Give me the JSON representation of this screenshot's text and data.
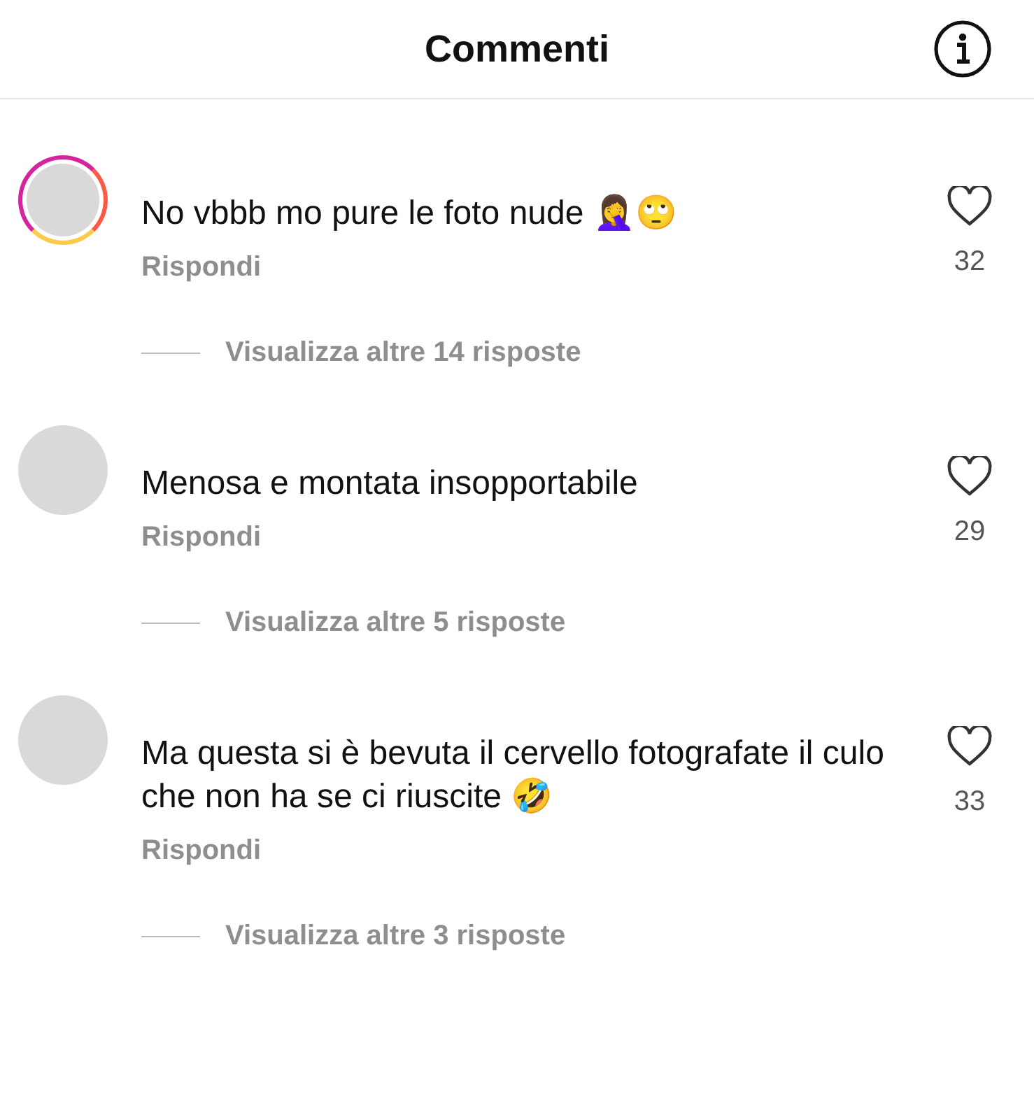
{
  "header": {
    "title": "Commenti"
  },
  "comments": [
    {
      "story_ring": true,
      "text": "No vbbb mo pure le foto nude 🤦‍♀️🙄",
      "reply": "Rispondi",
      "likes": "32",
      "more_replies": "Visualizza altre 14 risposte"
    },
    {
      "story_ring": false,
      "text": "Menosa e montata insopportabile",
      "reply": "Rispondi",
      "likes": "29",
      "more_replies": "Visualizza altre 5 risposte"
    },
    {
      "story_ring": false,
      "text": "Ma questa si è bevuta il cervello fotografate il culo che non ha se ci riuscite 🤣",
      "reply": "Rispondi",
      "likes": "33",
      "more_replies": "Visualizza altre 3 risposte"
    }
  ]
}
